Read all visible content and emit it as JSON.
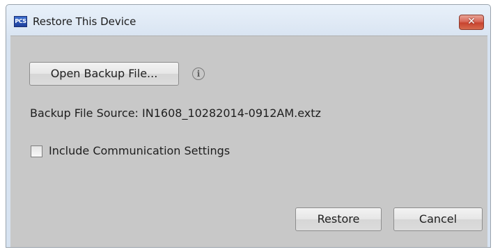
{
  "window": {
    "app_icon_text": "PCS",
    "title": "Restore This Device",
    "close_glyph": "✕"
  },
  "open_backup": {
    "label": "Open Backup File...",
    "info_icon": "info-circle-icon",
    "info_glyph": "i"
  },
  "backup_source": {
    "label": "Backup File Source:",
    "filename": "IN1608_10282014-0912AM.extz"
  },
  "include_comm": {
    "label": "Include Communication Settings",
    "checked": false
  },
  "footer": {
    "restore_label": "Restore",
    "cancel_label": "Cancel"
  },
  "colors": {
    "client_background": "#c8c8c8",
    "close_button": "#c8432f",
    "titlebar": "#dfe9f5"
  }
}
